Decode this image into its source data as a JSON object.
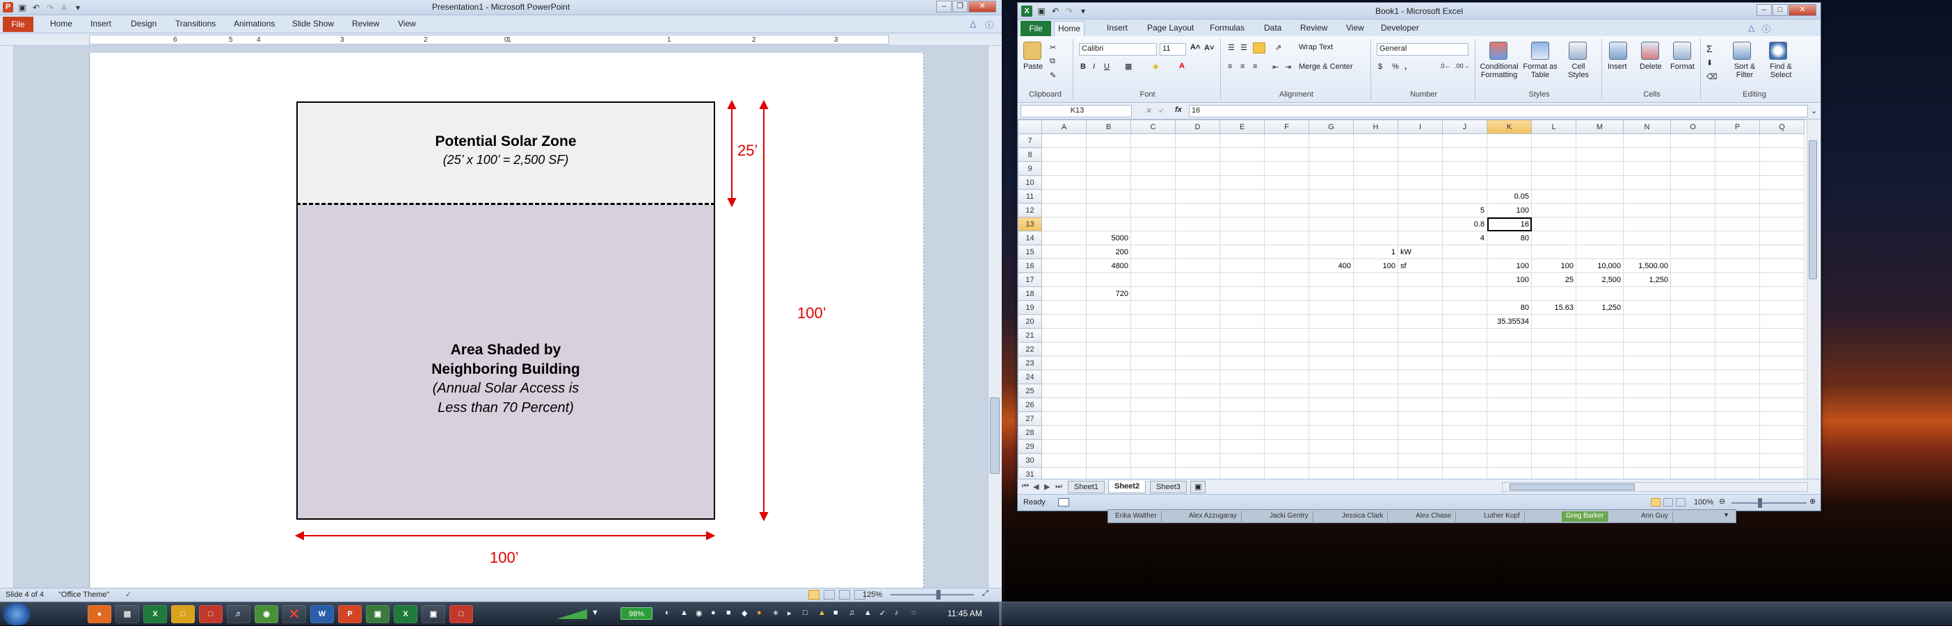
{
  "powerpoint": {
    "title": "Presentation1 - Microsoft PowerPoint",
    "tabs": [
      "File",
      "Home",
      "Insert",
      "Design",
      "Transitions",
      "Animations",
      "Slide Show",
      "Review",
      "View"
    ],
    "ruler_numbers": [
      "6",
      "5",
      "4",
      "3",
      "2",
      "1",
      "0",
      "1",
      "2",
      "3",
      "4",
      "5",
      "6"
    ],
    "status": {
      "slide": "Slide 4 of 4",
      "theme": "\"Office Theme\"",
      "zoom": "125%"
    }
  },
  "diagram": {
    "solar_zone_title": "Potential Solar Zone",
    "solar_zone_sub": "(25’ x 100’ = 2,500 SF)",
    "shaded_title_1": "Area Shaded by",
    "shaded_title_2": "Neighboring Building",
    "shaded_sub_1": "(Annual Solar Access is",
    "shaded_sub_2": "Less than 70 Percent)",
    "dim_25": "25’",
    "dim_100_right": "100’",
    "dim_100_bottom": "100’",
    "dim_color": "#e00000"
  },
  "excel": {
    "title": "Book1 - Microsoft Excel",
    "tabs": [
      "File",
      "Home",
      "Insert",
      "Page Layout",
      "Formulas",
      "Data",
      "Review",
      "View",
      "Developer"
    ],
    "ribbon": {
      "paste": "Paste",
      "clipboard": "Clipboard",
      "font_name": "Calibri",
      "font_size": "11",
      "font_group": "Font",
      "wrap_text": "Wrap Text",
      "merge_center": "Merge & Center",
      "alignment_group": "Alignment",
      "number_format": "General",
      "number_group": "Number",
      "conditional_formatting": "Conditional Formatting",
      "format_as_table": "Format as Table",
      "cell_styles": "Cell Styles",
      "styles_group": "Styles",
      "insert": "Insert",
      "delete": "Delete",
      "format": "Format",
      "cells_group": "Cells",
      "sort_filter": "Sort & Filter",
      "find_select": "Find & Select",
      "editing_group": "Editing"
    },
    "name_box": "K13",
    "fx": "fx",
    "formula": "16",
    "columns": [
      "A",
      "B",
      "C",
      "D",
      "E",
      "F",
      "G",
      "H",
      "I",
      "J",
      "K",
      "L",
      "M",
      "N",
      "O",
      "P",
      "Q"
    ],
    "rows": [
      {
        "n": "7",
        "cells": {}
      },
      {
        "n": "8",
        "cells": {}
      },
      {
        "n": "9",
        "cells": {}
      },
      {
        "n": "10",
        "cells": {}
      },
      {
        "n": "11",
        "cells": {
          "K": "0.05"
        }
      },
      {
        "n": "12",
        "cells": {
          "J": "5",
          "K": "100"
        }
      },
      {
        "n": "13",
        "cells": {
          "J": "0.8",
          "K": "16"
        }
      },
      {
        "n": "14",
        "cells": {
          "B": "5000",
          "J": "4",
          "K": "80"
        }
      },
      {
        "n": "15",
        "cells": {
          "B": "200",
          "H": "1",
          "I": "kW"
        }
      },
      {
        "n": "16",
        "cells": {
          "B": "4800",
          "G": "400",
          "H": "100",
          "I": "sf",
          "K": "100",
          "L": "100",
          "M": "10,000",
          "N": "1,500.00"
        }
      },
      {
        "n": "17",
        "cells": {
          "K": "100",
          "L": "25",
          "M": "2,500",
          "N": "1,250"
        }
      },
      {
        "n": "18",
        "cells": {
          "B": "720"
        }
      },
      {
        "n": "19",
        "cells": {
          "K": "80",
          "L": "15.63",
          "M": "1,250"
        }
      },
      {
        "n": "20",
        "cells": {
          "K": "35.35534"
        }
      },
      {
        "n": "21",
        "cells": {}
      },
      {
        "n": "22",
        "cells": {}
      },
      {
        "n": "23",
        "cells": {}
      },
      {
        "n": "24",
        "cells": {}
      },
      {
        "n": "25",
        "cells": {}
      },
      {
        "n": "26",
        "cells": {}
      },
      {
        "n": "27",
        "cells": {}
      },
      {
        "n": "28",
        "cells": {}
      },
      {
        "n": "29",
        "cells": {}
      },
      {
        "n": "30",
        "cells": {}
      },
      {
        "n": "31",
        "cells": {}
      }
    ],
    "sheets": [
      "Sheet1",
      "Sheet2",
      "Sheet3"
    ],
    "active_sheet": "Sheet2",
    "status": {
      "ready": "Ready",
      "zoom": "100%"
    }
  },
  "names_bar": [
    "Erika Walther",
    "Alex Azzugaray",
    "Jacki Gentry",
    "Jessica Clark",
    "Alex Chase",
    "Luther Kopf",
    "Greg Barker",
    "Ann Guy"
  ],
  "taskbar": {
    "battery": "98%",
    "time": "11:45 AM"
  }
}
